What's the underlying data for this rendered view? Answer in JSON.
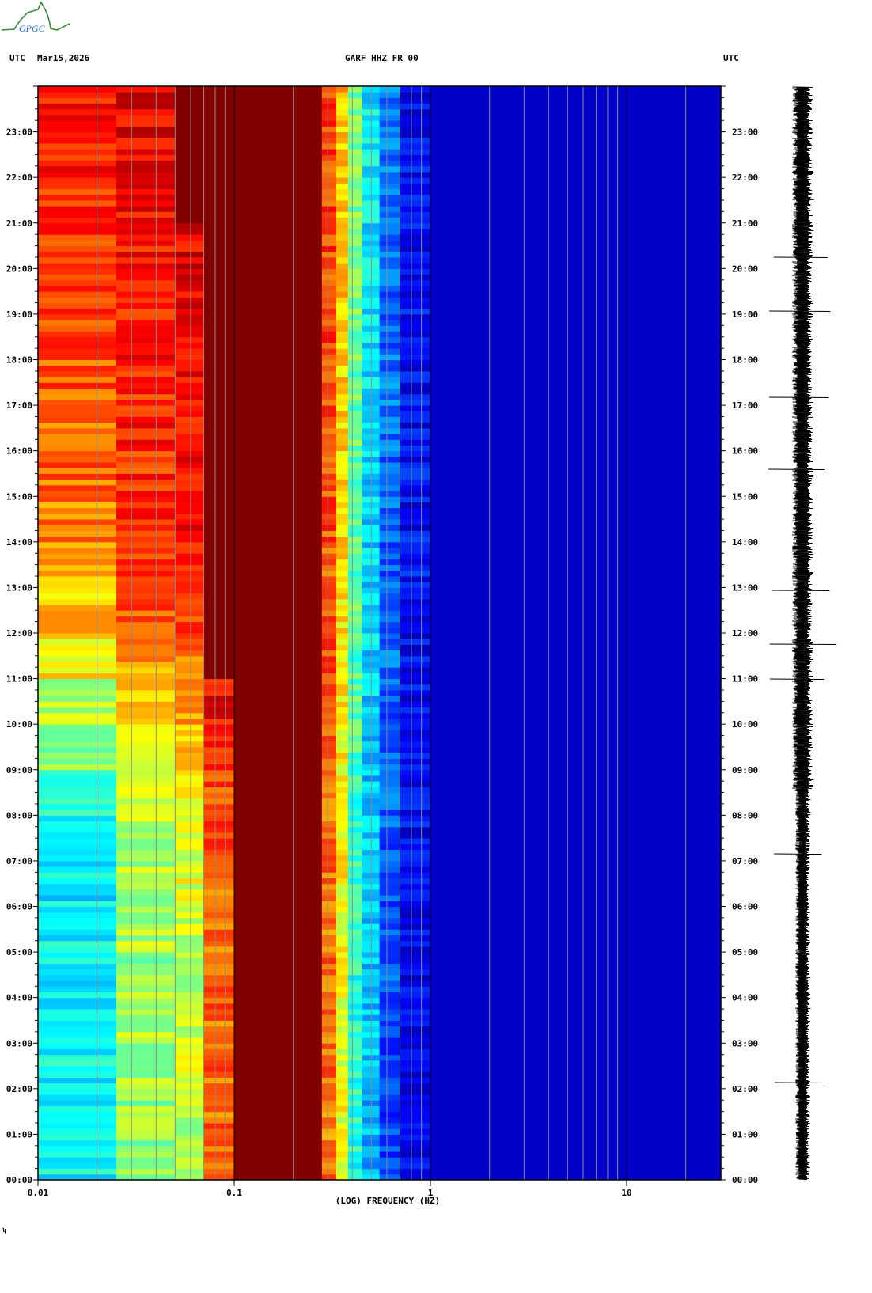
{
  "logo": {
    "text": "OPGC"
  },
  "header": {
    "left_tz": "UTC",
    "date": "Mar15,2026",
    "station": "GARF HHZ FR 00",
    "right_tz": "UTC"
  },
  "footer_mark": "ʮ",
  "chart_data": {
    "type": "heatmap",
    "title": "GARF HHZ FR 00",
    "xlabel": "(LOG) FREQUENCY (HZ)",
    "ylabel": "UTC",
    "xscale": "log",
    "xlim": [
      0.01,
      30
    ],
    "ylim": [
      0,
      24
    ],
    "x_ticks": [
      {
        "value": 0.01,
        "label": "0.01"
      },
      {
        "value": 0.1,
        "label": "0.1"
      },
      {
        "value": 1,
        "label": "1"
      },
      {
        "value": 10,
        "label": "10"
      }
    ],
    "y_ticks": [
      "00:00",
      "01:00",
      "02:00",
      "03:00",
      "04:00",
      "05:00",
      "06:00",
      "07:00",
      "08:00",
      "09:00",
      "10:00",
      "11:00",
      "12:00",
      "13:00",
      "14:00",
      "15:00",
      "16:00",
      "17:00",
      "18:00",
      "19:00",
      "20:00",
      "21:00",
      "22:00",
      "23:00"
    ],
    "gridlines_hz": [
      0.02,
      0.03,
      0.04,
      0.05,
      0.06,
      0.07,
      0.08,
      0.09,
      0.2,
      0.3,
      0.4,
      0.5,
      0.6,
      0.7,
      0.8,
      0.9,
      2,
      3,
      4,
      5,
      6,
      7,
      8,
      9,
      20
    ],
    "decade_lines_hz": [
      0.1,
      1,
      10
    ],
    "colormap": "jet (blue = low power, dark red = high power)",
    "freq_bands_hz": [
      [
        0.01,
        0.025
      ],
      [
        0.025,
        0.05
      ],
      [
        0.05,
        0.07
      ],
      [
        0.07,
        0.1
      ],
      [
        0.1,
        0.28
      ],
      [
        0.28,
        0.33
      ],
      [
        0.33,
        0.38
      ],
      [
        0.38,
        0.45
      ],
      [
        0.45,
        0.55
      ],
      [
        0.55,
        0.7
      ],
      [
        0.7,
        1
      ],
      [
        1,
        30
      ]
    ],
    "hours": [
      0,
      1,
      2,
      3,
      4,
      5,
      6,
      7,
      8,
      9,
      10,
      11,
      12,
      13,
      14,
      15,
      16,
      17,
      18,
      19,
      20,
      21,
      22,
      23
    ],
    "intensity": [
      [
        0.42,
        0.4,
        0.42,
        0.38,
        0.4,
        0.42,
        0.4,
        0.42,
        0.44,
        0.55,
        0.62,
        0.7,
        0.76,
        0.8,
        0.84,
        0.86,
        0.86,
        0.88,
        0.88,
        0.9,
        0.9,
        0.92,
        0.94,
        0.97
      ],
      [
        0.58,
        0.58,
        0.6,
        0.6,
        0.58,
        0.6,
        0.6,
        0.62,
        0.62,
        0.66,
        0.72,
        0.8,
        0.88,
        0.9,
        0.93,
        0.93,
        0.94,
        0.94,
        0.95,
        0.95,
        0.96,
        0.97,
        0.98,
        0.99
      ],
      [
        0.64,
        0.62,
        0.64,
        0.64,
        0.62,
        0.64,
        0.66,
        0.66,
        0.68,
        0.74,
        0.8,
        0.86,
        0.9,
        0.94,
        0.96,
        0.97,
        0.97,
        0.98,
        0.98,
        0.99,
        0.99,
        1,
        1,
        1
      ],
      [
        0.86,
        0.86,
        0.86,
        0.86,
        0.86,
        0.86,
        0.86,
        0.88,
        0.9,
        0.94,
        0.98,
        1,
        1,
        1,
        1,
        1,
        1,
        1,
        1,
        1,
        1,
        1,
        1,
        1
      ],
      [
        1,
        1,
        1,
        1,
        1,
        1,
        1,
        1,
        1,
        1,
        1,
        1,
        1,
        1,
        1,
        1,
        1,
        1,
        1,
        1,
        1,
        1,
        1,
        1
      ],
      [
        0.84,
        0.84,
        0.85,
        0.84,
        0.85,
        0.85,
        0.86,
        0.86,
        0.86,
        0.87,
        0.87,
        0.88,
        0.88,
        0.88,
        0.89,
        0.89,
        0.9,
        0.9,
        0.9,
        0.9,
        0.9,
        0.9,
        0.9,
        0.9
      ],
      [
        0.68,
        0.68,
        0.68,
        0.68,
        0.69,
        0.69,
        0.7,
        0.7,
        0.7,
        0.7,
        0.72,
        0.72,
        0.72,
        0.72,
        0.74,
        0.74,
        0.74,
        0.74,
        0.75,
        0.75,
        0.75,
        0.75,
        0.76,
        0.76
      ],
      [
        0.45,
        0.45,
        0.46,
        0.46,
        0.46,
        0.47,
        0.47,
        0.48,
        0.48,
        0.5,
        0.5,
        0.5,
        0.52,
        0.52,
        0.52,
        0.52,
        0.53,
        0.53,
        0.54,
        0.54,
        0.55,
        0.55,
        0.55,
        0.55
      ],
      [
        0.34,
        0.34,
        0.35,
        0.35,
        0.35,
        0.35,
        0.36,
        0.36,
        0.36,
        0.37,
        0.37,
        0.37,
        0.38,
        0.38,
        0.38,
        0.38,
        0.38,
        0.38,
        0.39,
        0.39,
        0.4,
        0.4,
        0.4,
        0.4
      ],
      [
        0.22,
        0.22,
        0.22,
        0.23,
        0.23,
        0.23,
        0.23,
        0.24,
        0.24,
        0.24,
        0.24,
        0.25,
        0.25,
        0.25,
        0.25,
        0.25,
        0.25,
        0.26,
        0.26,
        0.26,
        0.26,
        0.26,
        0.26,
        0.26
      ],
      [
        0.12,
        0.12,
        0.12,
        0.12,
        0.12,
        0.13,
        0.13,
        0.13,
        0.13,
        0.13,
        0.13,
        0.14,
        0.14,
        0.14,
        0.14,
        0.14,
        0.14,
        0.14,
        0.14,
        0.14,
        0.14,
        0.14,
        0.14,
        0.14
      ],
      [
        0.08,
        0.08,
        0.08,
        0.08,
        0.08,
        0.08,
        0.08,
        0.08,
        0.08,
        0.08,
        0.08,
        0.08,
        0.08,
        0.08,
        0.08,
        0.08,
        0.08,
        0.08,
        0.08,
        0.08,
        0.08,
        0.08,
        0.08,
        0.08
      ]
    ],
    "legend": "none"
  }
}
